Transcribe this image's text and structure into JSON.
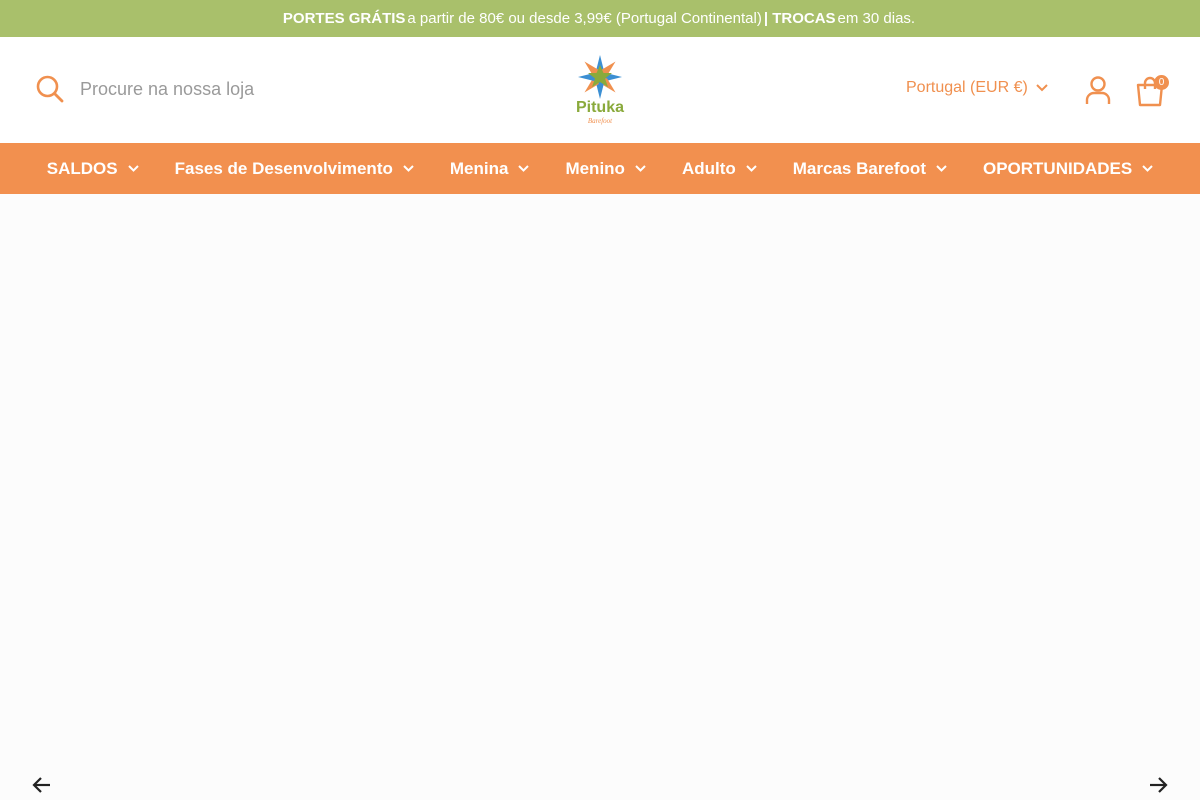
{
  "announcement": {
    "part1": "PORTES GRÁTIS",
    "part2": "a partir de 80€ ou desde 3,99€ (Portugal Continental)",
    "part3": "| TROCAS",
    "part4": "em 30 dias."
  },
  "header": {
    "search_placeholder": "Procure na nossa loja",
    "logo_name": "Pituka",
    "logo_tagline": "Barefoot",
    "currency": "Portugal (EUR €)",
    "cart_count": "0"
  },
  "nav": {
    "items": [
      {
        "label": "SALDOS"
      },
      {
        "label": "Fases de Desenvolvimento"
      },
      {
        "label": "Menina"
      },
      {
        "label": "Menino"
      },
      {
        "label": "Adulto"
      },
      {
        "label": "Marcas Barefoot"
      },
      {
        "label": "OPORTUNIDADES"
      }
    ]
  },
  "colors": {
    "announcement_bg": "#a9c06b",
    "accent_orange": "#f2904f",
    "logo_green": "#8aaa3c",
    "logo_blue": "#3b8fd3"
  },
  "icons": {
    "search": "search-icon",
    "account": "account-icon",
    "cart": "cart-icon",
    "chevron": "chevron-down-icon",
    "prev": "arrow-left-icon",
    "next": "arrow-right-icon"
  }
}
